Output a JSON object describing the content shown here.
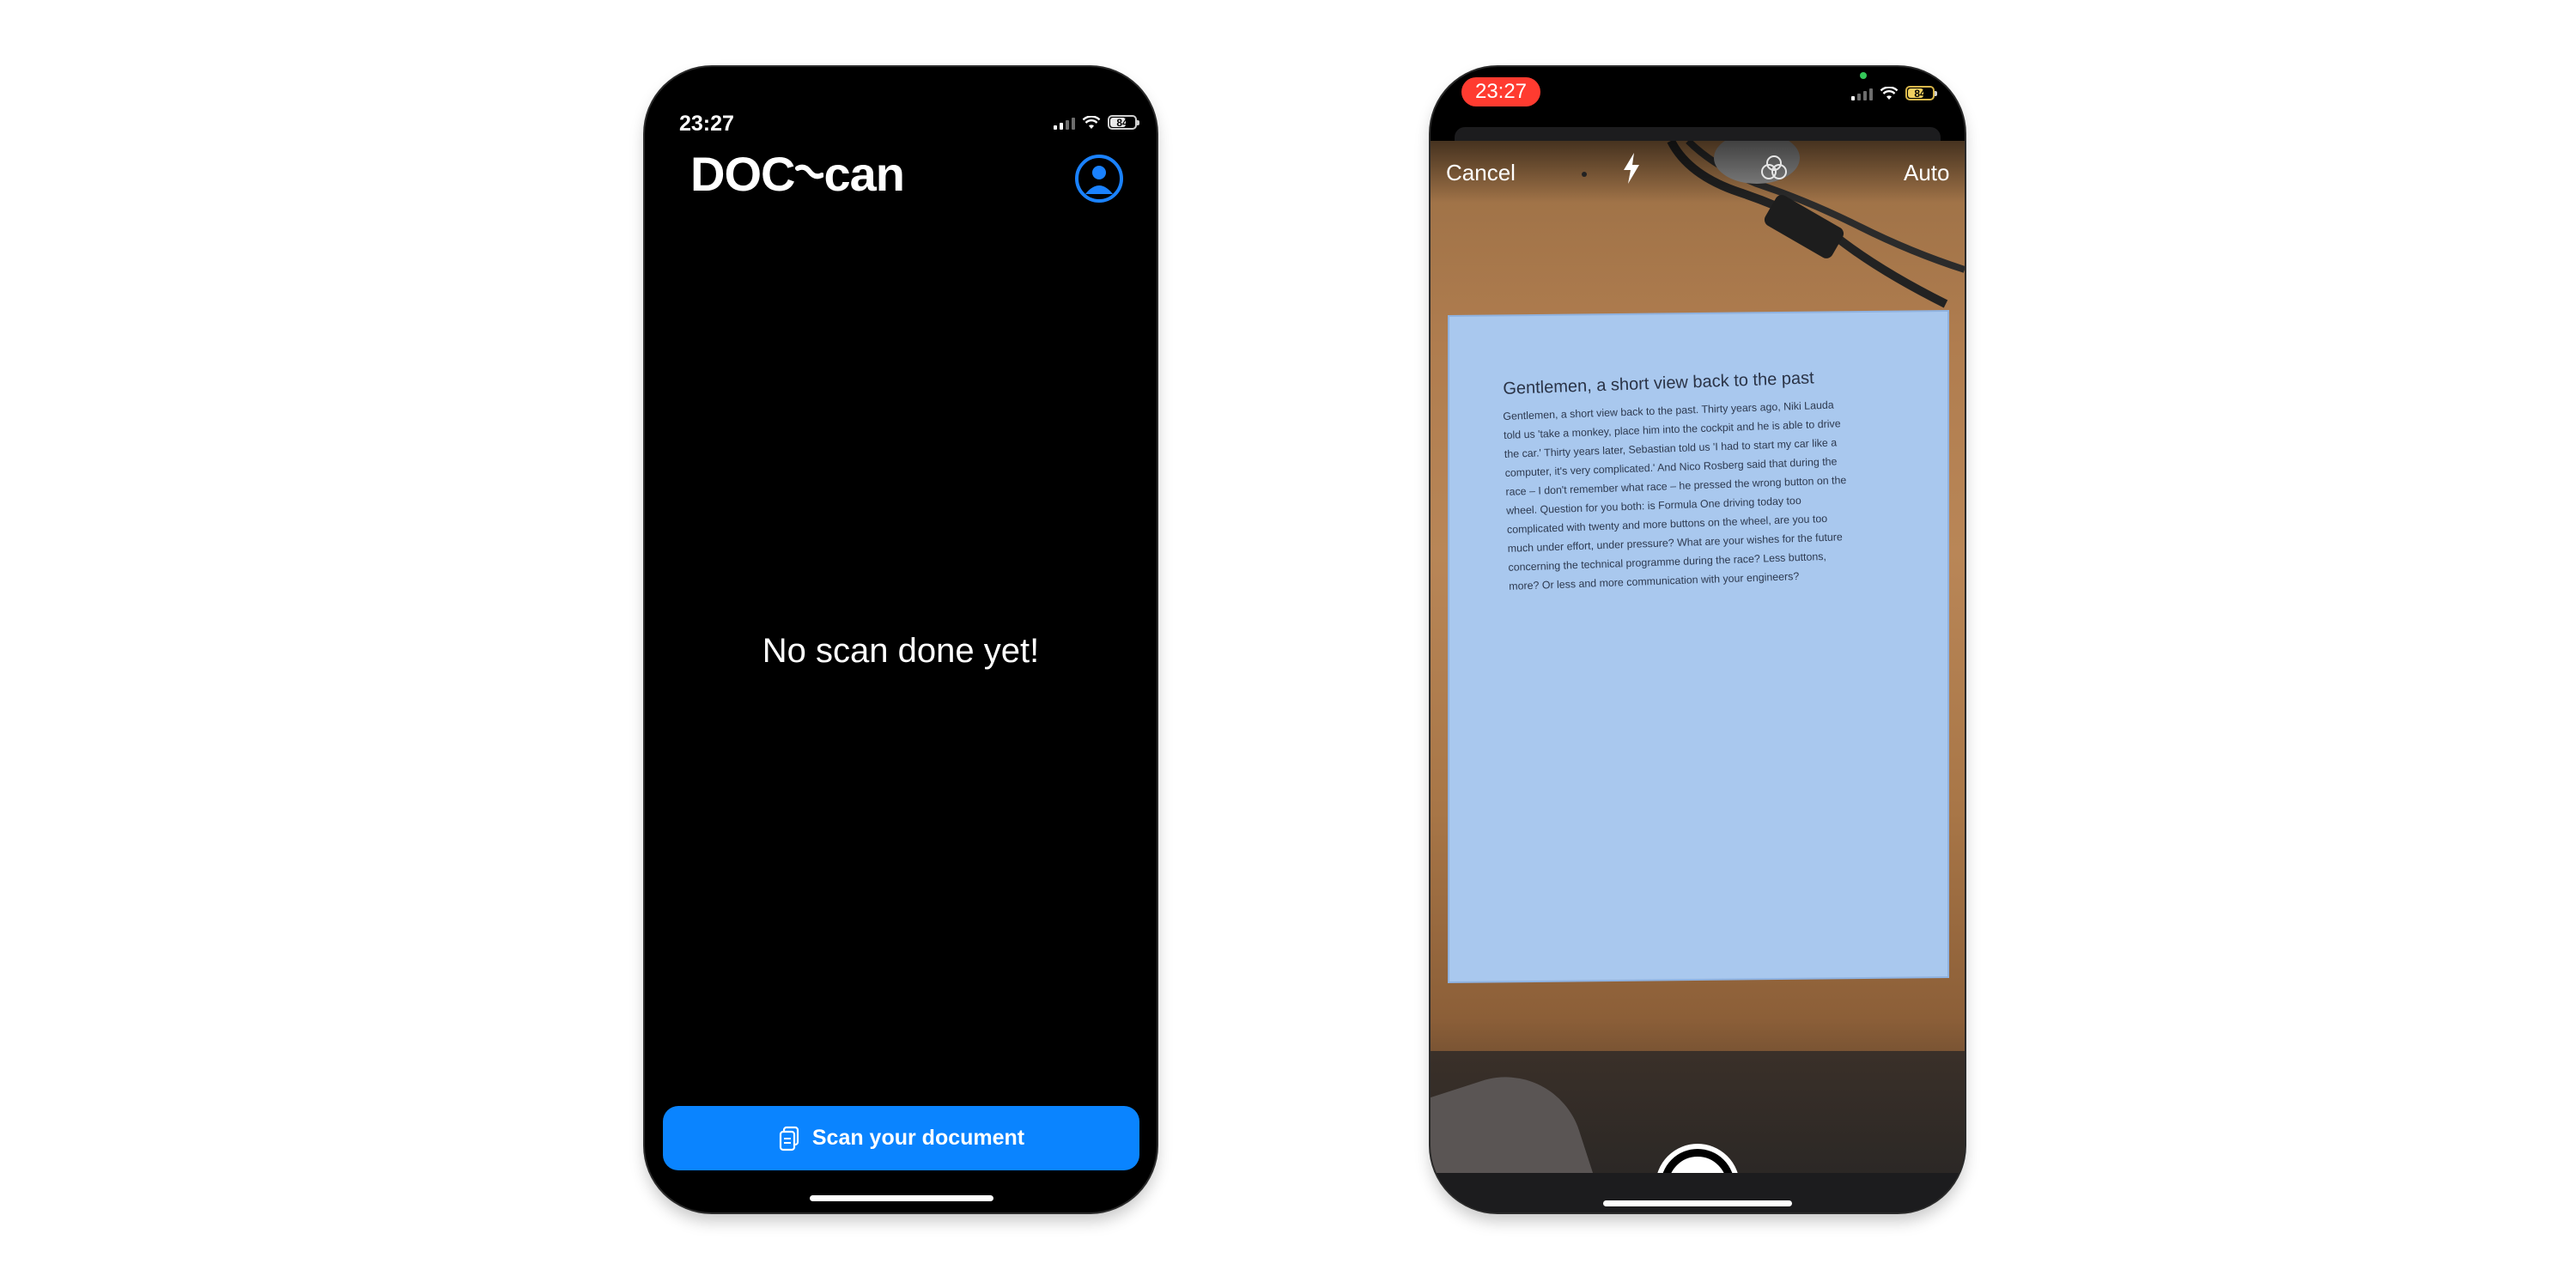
{
  "left_screen": {
    "status": {
      "time": "23:27",
      "battery": "84"
    },
    "app": {
      "logo_text_a": "DOC",
      "logo_text_b": "can",
      "brand_color": "#0a84ff"
    },
    "profile_icon": "person-circle-icon",
    "empty_state": {
      "message": "No scan done yet!"
    },
    "scan_button": {
      "label": "Scan your document",
      "icon": "documents-icon"
    }
  },
  "right_screen": {
    "status": {
      "time": "23:27",
      "battery": "84"
    },
    "camera_toolbar": {
      "cancel_label": "Cancel",
      "flash_icon": "flash-icon",
      "filter_icon": "color-filter-icon",
      "mode_label": "Auto"
    },
    "scanned_document": {
      "title": "Gentlemen, a short view back to the past",
      "body": "Gentlemen, a short view back to the past. Thirty years ago, Niki Lauda told us 'take a monkey, place him into the cockpit and he is able to drive the car.' Thirty years later, Sebastian told us 'I had to start my car like a computer, it's very complicated.' And Nico Rosberg said that during the race – I don't remember what race – he pressed the wrong button on the wheel. Question for you both: is Formula One driving today too complicated with twenty and more buttons on the wheel, are you too much under effort, under pressure? What are your wishes for the future concerning the technical programme during the race? Less buttons, more? Or less and more communication with your engineers?"
    },
    "shutter_button": "shutter-button"
  }
}
